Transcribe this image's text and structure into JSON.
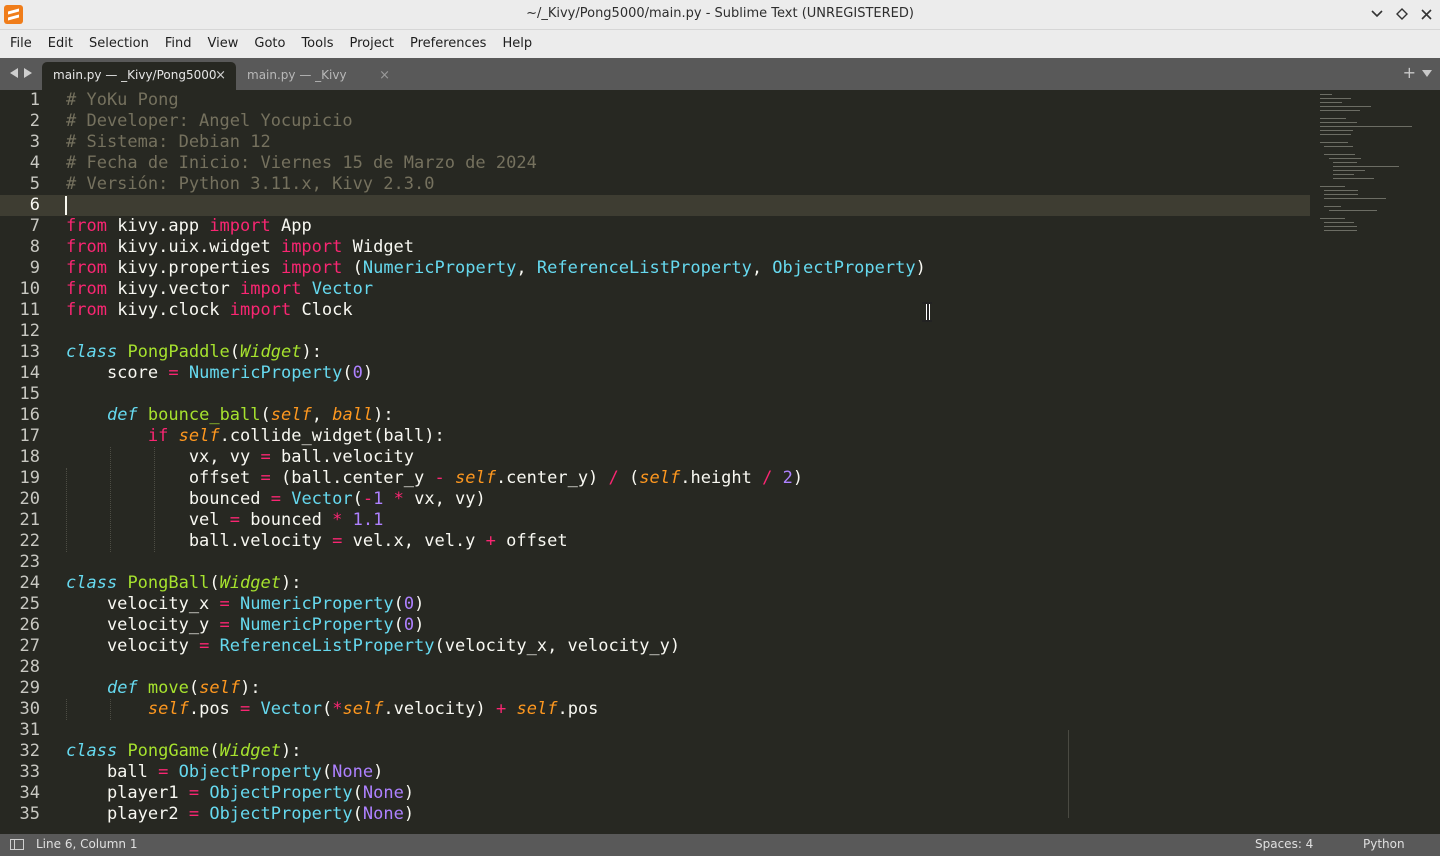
{
  "window": {
    "title": "~/_Kivy/Pong5000/main.py - Sublime Text (UNREGISTERED)",
    "icons": [
      "sublime-text-icon",
      "chevron-down-icon",
      "restore-icon",
      "close-icon"
    ]
  },
  "menu": [
    "File",
    "Edit",
    "Selection",
    "Find",
    "View",
    "Goto",
    "Tools",
    "Project",
    "Preferences",
    "Help"
  ],
  "tabs": [
    {
      "label": "main.py — _Kivy/Pong5000",
      "active": true,
      "close": "×"
    },
    {
      "label": "main.py — _Kivy",
      "active": false,
      "close": "×"
    }
  ],
  "tabbar": {
    "new_tab": "+"
  },
  "editor": {
    "current_line": 6,
    "line_numbers": [
      "1",
      "2",
      "3",
      "4",
      "5",
      "6",
      "7",
      "8",
      "9",
      "10",
      "11",
      "12",
      "13",
      "14",
      "15",
      "16",
      "17",
      "18",
      "19",
      "20",
      "21",
      "22",
      "23",
      "24",
      "25",
      "26",
      "27",
      "28",
      "29",
      "30",
      "31",
      "32",
      "33",
      "34",
      "35"
    ],
    "lines": [
      "# YoKu Pong",
      "# Developer: Angel Yocupicio",
      "# Sistema: Debian 12",
      "# Fecha de Inicio: Viernes 15 de Marzo de 2024",
      "# Versión: Python 3.11.x, Kivy 2.3.0",
      "",
      "from kivy.app import App",
      "from kivy.uix.widget import Widget",
      "from kivy.properties import (NumericProperty, ReferenceListProperty, ObjectProperty)",
      "from kivy.vector import Vector",
      "from kivy.clock import Clock",
      "",
      "class PongPaddle(Widget):",
      "    score = NumericProperty(0)",
      "",
      "    def bounce_ball(self, ball):",
      "        if self.collide_widget(ball):",
      "            vx, vy = ball.velocity",
      "            offset = (ball.center_y - self.center_y) / (self.height / 2)",
      "            bounced = Vector(-1 * vx, vy)",
      "            vel = bounced * 1.1",
      "            ball.velocity = vel.x, vel.y + offset",
      "",
      "class PongBall(Widget):",
      "    velocity_x = NumericProperty(0)",
      "    velocity_y = NumericProperty(0)",
      "    velocity = ReferenceListProperty(velocity_x, velocity_y)",
      "",
      "    def move(self):",
      "        self.pos = Vector(*self.velocity) + self.pos",
      "",
      "class PongGame(Widget):",
      "    ball = ObjectProperty(None)",
      "    player1 = ObjectProperty(None)",
      "    player2 = ObjectProperty(None)"
    ]
  },
  "status": {
    "position": "Line 6, Column 1",
    "spaces": "Spaces: 4",
    "syntax": "Python"
  },
  "colors": {
    "background": "#272822",
    "comment": "#75715e",
    "keyword": "#f92672",
    "function": "#a6e22e",
    "builtin": "#66d9ef",
    "parameter": "#fd971f",
    "number": "#ae81ff"
  }
}
